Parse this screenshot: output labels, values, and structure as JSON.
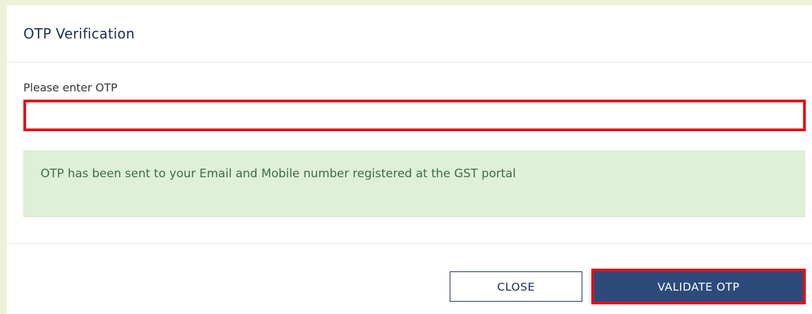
{
  "modal": {
    "title": "OTP Verification"
  },
  "form": {
    "otp_label": "Please enter OTP",
    "otp_value": "",
    "otp_placeholder": ""
  },
  "alert": {
    "message": "OTP has been sent to your Email and Mobile number registered at the GST portal"
  },
  "footer": {
    "close_label": "CLOSE",
    "validate_label": "VALIDATE OTP"
  },
  "colors": {
    "page_background": "#eef2d8",
    "primary_button": "#2e4a7a",
    "highlight_border": "#e0121b",
    "success_background": "#dff0d8",
    "title_text": "#1d2d55"
  }
}
